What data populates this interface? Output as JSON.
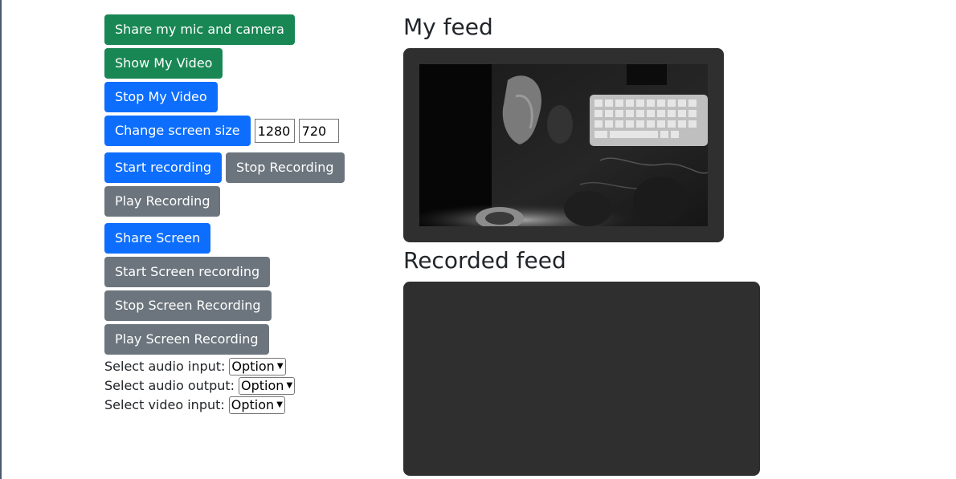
{
  "buttons": {
    "share_mic_camera": "Share my mic and camera",
    "show_my_video": "Show My Video",
    "stop_my_video": "Stop My Video",
    "change_screen_size": "Change screen size",
    "start_recording": "Start recording",
    "stop_recording": "Stop Recording",
    "play_recording": "Play Recording",
    "share_screen": "Share Screen",
    "start_screen_recording": "Start Screen recording",
    "stop_screen_recording": "Stop Screen Recording",
    "play_screen_recording": "Play Screen Recording"
  },
  "screen_size": {
    "width": "1280",
    "height": "720"
  },
  "selects": {
    "audio_input": {
      "label": "Select audio input:",
      "value": "Option"
    },
    "audio_output": {
      "label": "Select audio output:",
      "value": "Option"
    },
    "video_input": {
      "label": "Select video input:",
      "value": "Option"
    }
  },
  "feeds": {
    "my_feed_title": "My feed",
    "recorded_feed_title": "Recorded feed"
  },
  "colors": {
    "success": "#198754",
    "primary": "#0d6efd",
    "secondary": "#6c757d",
    "panel": "#2f2f2f"
  }
}
